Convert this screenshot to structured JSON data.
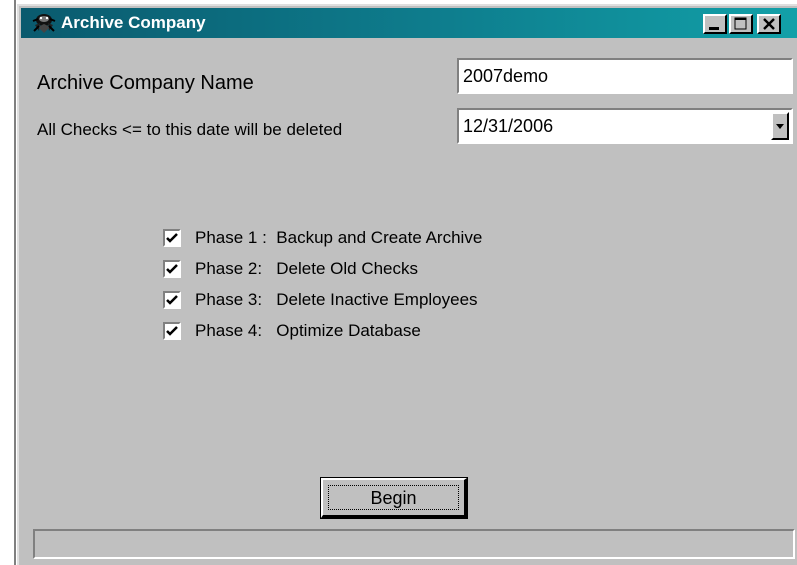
{
  "window": {
    "title": "Archive Company",
    "buttons": {
      "minimize": "minimize-icon",
      "maximize": "maximize-icon",
      "close": "close-icon"
    }
  },
  "form": {
    "company_name_label": "Archive Company Name",
    "company_name_value": "2007demo",
    "date_label": "All Checks <= to this date will be deleted",
    "date_value": "12/31/2006"
  },
  "phases": [
    {
      "label": "Phase 1 :  Backup and Create Archive",
      "checked": true
    },
    {
      "label": "Phase 2:   Delete Old Checks",
      "checked": true
    },
    {
      "label": "Phase 3:   Delete Inactive Employees",
      "checked": true
    },
    {
      "label": "Phase 4:   Optimize Database",
      "checked": true
    }
  ],
  "actions": {
    "begin_label": "Begin"
  },
  "status": {
    "text": ""
  },
  "colors": {
    "face": "#c0c0c0",
    "title_start": "#0a5a6e",
    "title_end": "#12a0a8"
  }
}
